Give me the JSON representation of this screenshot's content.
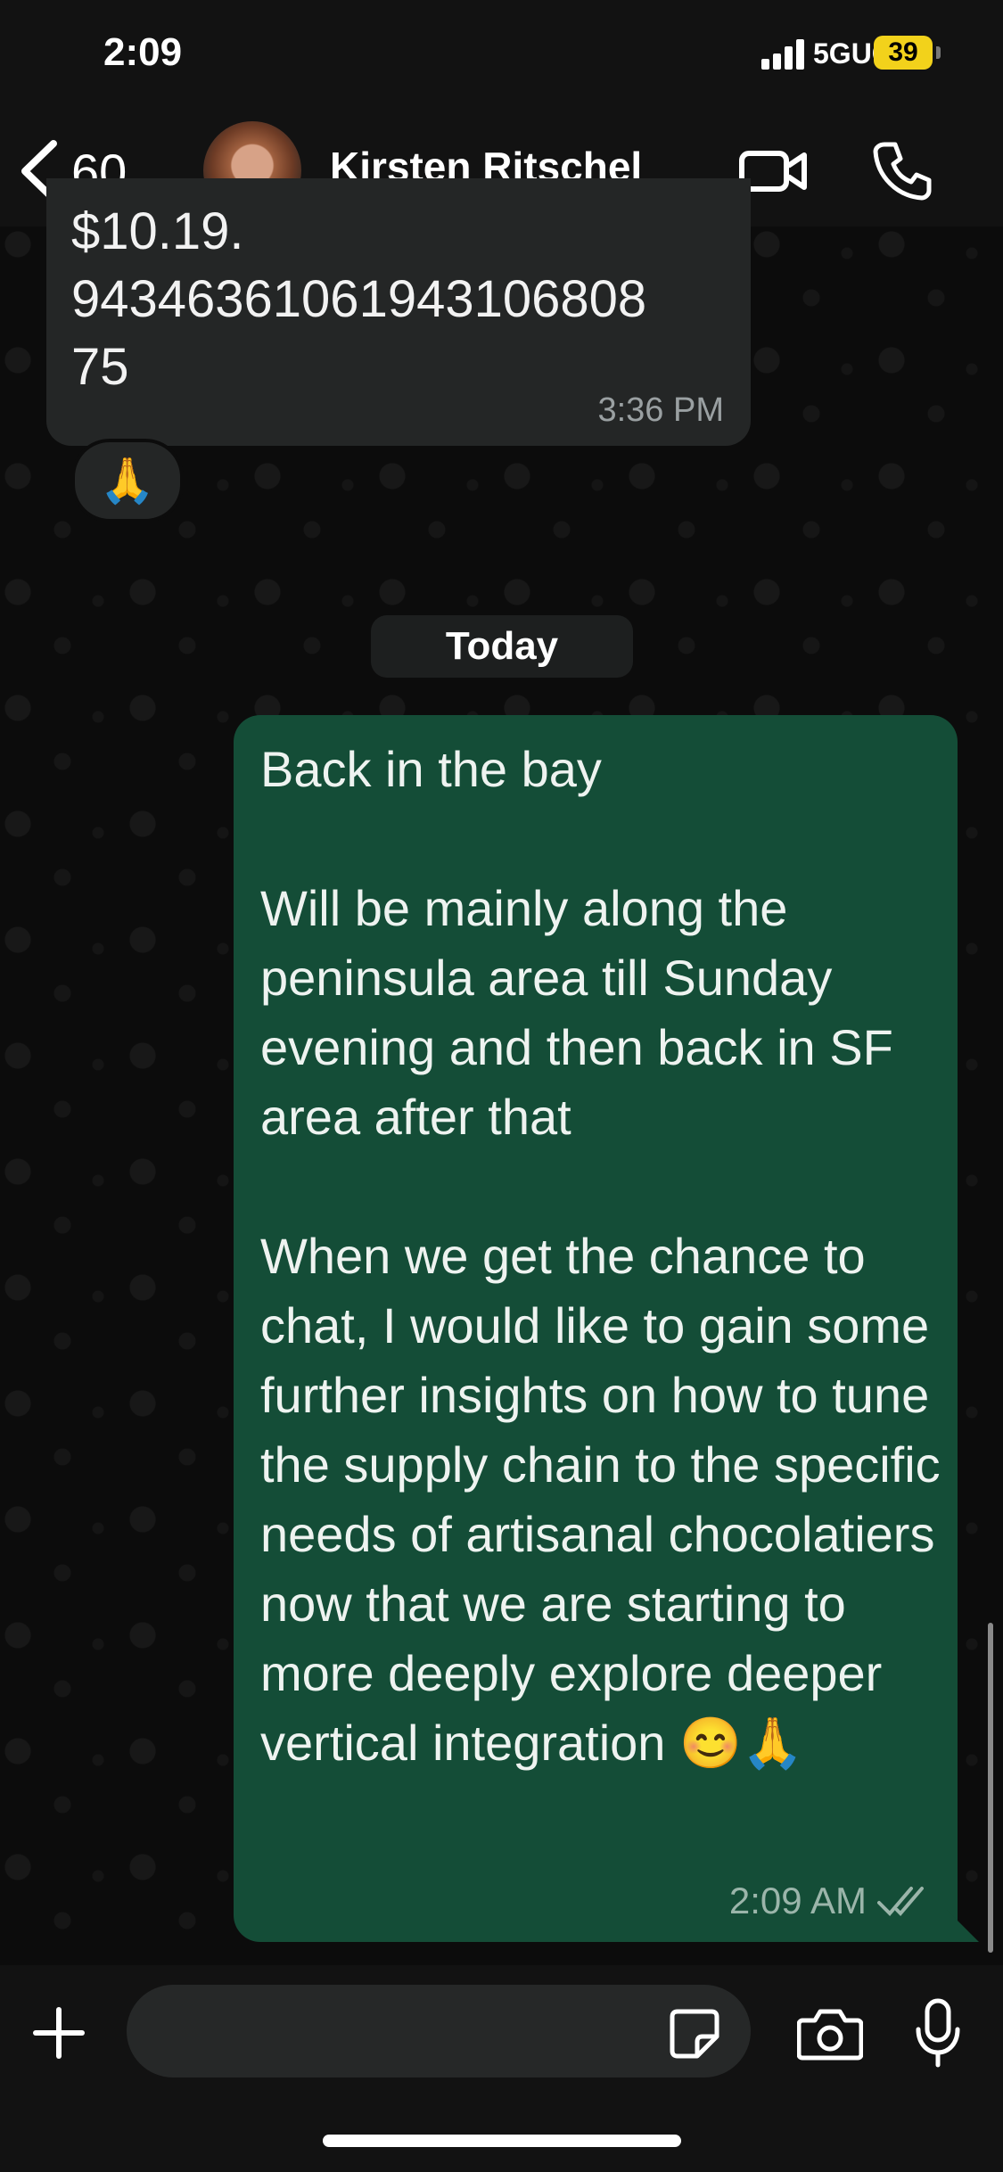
{
  "status_bar": {
    "time": "2:09",
    "network": "5GUC",
    "battery": "39"
  },
  "header": {
    "back_count": "60",
    "contact_name": "Kirsten Ritschel",
    "icons": [
      "back-chevron-icon",
      "video-call-icon",
      "phone-icon"
    ]
  },
  "messages": {
    "incoming": {
      "text": "$10.19.\n943463610619431068​08\n75",
      "time": "3:36 PM",
      "reaction": "🙏"
    },
    "date_divider": "Today",
    "outgoing": {
      "text": "Back in the bay\n\nWill be mainly along the peninsula area till Sunday evening and then back in SF area after that\n\nWhen we get the chance to chat, I would like to gain some further insights on how to tune the supply chain to the specific needs of artisanal chocolatiers now that we are starting to more deeply explore deeper vertical integration 😊🙏",
      "time": "2:09 AM",
      "status": "read"
    }
  },
  "composer": {
    "value": "",
    "icons": [
      "plus-icon",
      "sticker-icon",
      "camera-icon",
      "microphone-icon"
    ]
  },
  "colors": {
    "outgoing_bubble": "#144d37",
    "incoming_bubble": "#242626",
    "battery": "#f2d21b"
  }
}
